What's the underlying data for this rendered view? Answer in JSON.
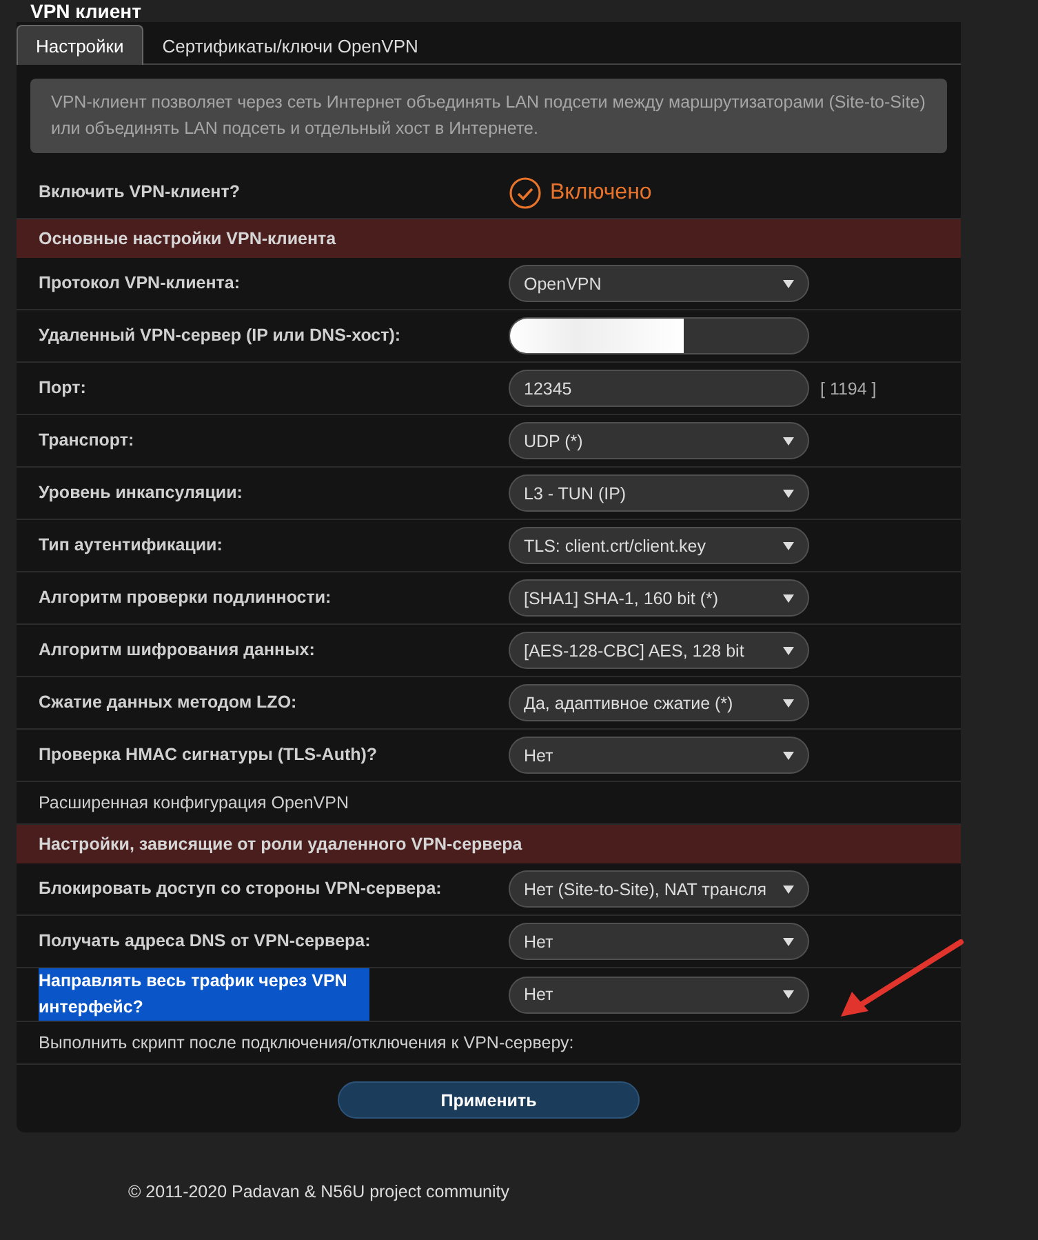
{
  "page_title": "VPN клиент",
  "tabs": [
    {
      "label": "Настройки",
      "selected": true
    },
    {
      "label": "Сертификаты/ключи OpenVPN",
      "selected": false
    }
  ],
  "info": "VPN-клиент позволяет через сеть Интернет объединять LAN подсети между маршрутизаторами (Site-to-Site) или объединять LAN подсеть и отдельный хост в Интернете.",
  "rows": [
    {
      "kind": "toggle",
      "label": "Включить VPN-клиент?",
      "value": "Включено",
      "on": true,
      "highlighted": false
    },
    {
      "kind": "header",
      "label": "Основные настройки VPN-клиента"
    },
    {
      "kind": "select",
      "label": "Протокол VPN-клиента:",
      "value": "OpenVPN",
      "highlighted": false
    },
    {
      "kind": "input",
      "label": "Удаленный VPN-сервер (IP или DNS-хост):",
      "redacted": true,
      "highlighted": false
    },
    {
      "kind": "input",
      "label": "Порт:",
      "value": "12345",
      "hint": "[ 1194 ]",
      "redacted": false,
      "highlighted": false
    },
    {
      "kind": "select",
      "label": "Транспорт:",
      "value": "UDP (*)",
      "highlighted": false
    },
    {
      "kind": "select",
      "label": "Уровень инкапсуляции:",
      "value": "L3 - TUN (IP)",
      "highlighted": false
    },
    {
      "kind": "select",
      "label": "Тип аутентификации:",
      "value": "TLS: client.crt/client.key",
      "highlighted": false
    },
    {
      "kind": "select",
      "label": "Алгоритм проверки подлинности:",
      "value": "[SHA1] SHA-1, 160 bit (*)",
      "highlighted": false
    },
    {
      "kind": "select",
      "label": "Алгоритм шифрования данных:",
      "value": "[AES-128-CBC] AES, 128 bit",
      "highlighted": false
    },
    {
      "kind": "select",
      "label": "Сжатие данных методом LZO:",
      "value": "Да, адаптивное сжатие (*)",
      "highlighted": false
    },
    {
      "kind": "select",
      "label": "Проверка HMAC сигнатуры (TLS-Auth)?",
      "value": "Нет",
      "highlighted": false
    },
    {
      "kind": "link",
      "label": "Расширенная конфигурация OpenVPN"
    },
    {
      "kind": "header",
      "label": "Настройки, зависящие от роли удаленного VPN-сервера"
    },
    {
      "kind": "select",
      "label": "Блокировать доступ со стороны VPN-сервера:",
      "value": "Нет (Site-to-Site), NAT трансля",
      "highlighted": false
    },
    {
      "kind": "select",
      "label": "Получать адреса DNS от VPN-сервера:",
      "value": "Нет",
      "highlighted": false
    },
    {
      "kind": "select",
      "label": "Направлять весь трафик через VPN интерфейс?",
      "value": "Нет",
      "highlighted": true
    },
    {
      "kind": "link",
      "label": "Выполнить скрипт после подключения/отключения к VPN-серверу:"
    }
  ],
  "apply_button": "Применить",
  "footer": "© 2011-2020 Padavan & N56U project community"
}
